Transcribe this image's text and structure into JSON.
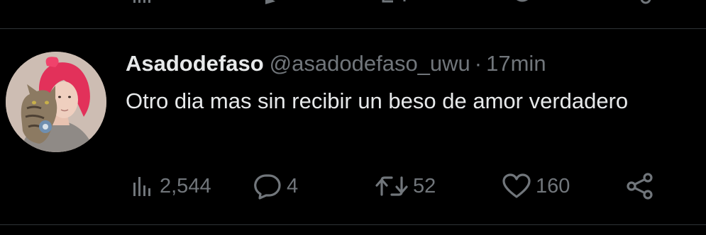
{
  "tweet": {
    "display_name": "Asadodefaso",
    "handle": "@asadodefaso_uwu",
    "separator": "·",
    "time": "17min",
    "text": "Otro dia mas sin recibir un beso de amor verdadero",
    "avatar_icon": "avatar-photo",
    "actions": {
      "views": {
        "icon": "views-bar-chart-icon",
        "count": "2,544"
      },
      "reply": {
        "icon": "reply-bubble-icon",
        "count": "4"
      },
      "retweet": {
        "icon": "retweet-arrows-icon",
        "count": "52"
      },
      "like": {
        "icon": "heart-icon",
        "count": "160"
      },
      "share": {
        "icon": "share-icon"
      }
    }
  },
  "colors": {
    "background": "#000000",
    "primary_text": "#e7e9ea",
    "secondary_text": "#71767b",
    "divider": "#2f3336"
  }
}
